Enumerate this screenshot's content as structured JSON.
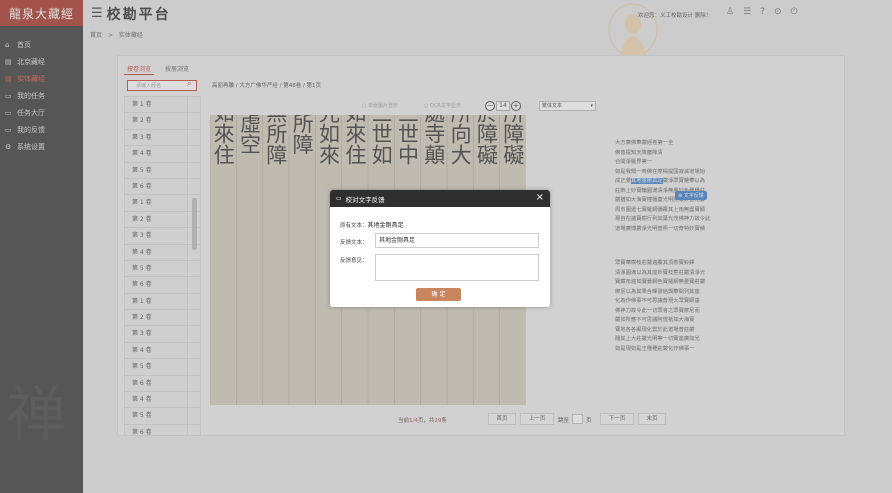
{
  "app": {
    "logo_text": "龍泉大藏經",
    "title": "校勘平台"
  },
  "sidebar": {
    "items": [
      {
        "label": "首页",
        "icon": "home-icon",
        "glyph": "⌂",
        "active": false
      },
      {
        "label": "北京藏经",
        "icon": "book-icon",
        "glyph": "▤",
        "active": false
      },
      {
        "label": "实体藏经",
        "icon": "book-icon",
        "glyph": "▤",
        "active": true
      },
      {
        "label": "我的任务",
        "icon": "task-icon",
        "glyph": "▭",
        "active": false
      },
      {
        "label": "任务大厅",
        "icon": "hall-icon",
        "glyph": "▭",
        "active": false
      },
      {
        "label": "我的反馈",
        "icon": "feedback-icon",
        "glyph": "▭",
        "active": false
      },
      {
        "label": "系统设置",
        "icon": "gear-icon",
        "glyph": "⚙",
        "active": false
      }
    ]
  },
  "header": {
    "welcome": "欢迎您：义工校勘设计 删除！"
  },
  "breadcrumb": {
    "home": "首页",
    "sep": ">",
    "current": "实体藏经"
  },
  "tabs": [
    {
      "label": "按卷浏览",
      "active": true
    },
    {
      "label": "按册浏览",
      "active": false
    }
  ],
  "search": {
    "placeholder": "请输入经名"
  },
  "volumes": [
    "第 1 卷",
    "第 2 卷",
    "第 3 卷",
    "第 4 卷",
    "第 5 卷",
    "第 6 卷",
    "第 1 卷",
    "第 2 卷",
    "第 3 卷",
    "第 4 卷",
    "第 5 卷",
    "第 6 卷",
    "第 1 卷",
    "第 2 卷",
    "第 3 卷",
    "第 4 卷",
    "第 5 卷",
    "第 6 卷",
    "第 4 卷",
    "第 5 卷",
    "第 6 卷"
  ],
  "viewer": {
    "path": "高丽再雕 / 大方广佛华严经 / 第48卷 / 第1页",
    "option_a": "单张图片显示",
    "option_b": "OCR文字显示",
    "page_value": "14",
    "text_select": "繁体文本",
    "minus": "−",
    "plus": "+"
  },
  "scan_columns": [
    "無所障礙",
    "前於障礙",
    "然所向大",
    "非處寺顛",
    "于三世中",
    "法三世如",
    "住如來住",
    "陰光如來",
    "無所障",
    "障無所障",
    "如虛空",
    "障如來住"
  ],
  "text_lines": {
    "p1": [
      "大方廣佛華嚴經卷第一全",
      "佛菩提知天降魔降清",
      "合開淨羅界第一",
      "如是我聞一時佛在摩揭提國寂滅道場始",
      "成正覺其地金剛具足嚴淨眾寶雜華以為",
      "莊飾上妙寶輪圓滿清淨無量妙色種種莊",
      "嚴猶如大海寶幢幡蓋光明照耀妙香花鬘",
      "周市圍遶七寶羅網彌覆其上雨無盡寶顯",
      "現自在諸寶樹行列其葉光茂佛神力故令此",
      "道場廣博嚴淨光明普照一切奇特妙寶積"
    ],
    "hl_before": "成正覺",
    "hl_text": "其地金剛具足",
    "hl_after": "嚴淨眾寶雜華以為",
    "p2": [
      "眾寶華樹枝莊嚴遍覆其頂懸寶鈴鐸",
      "清淨圓滿以為其座妙寶枝莖莊嚴清淨光",
      "寶藏布遍如寶蔓網色寶羅網無量寶莊嚴",
      "摩尼以為其果含暉發焰與華間列其座",
      "化為作佛事不可思議普現大眾寶網垂",
      "佛神力故令此一切眾會之眾寶摩尼而",
      "嚴如所應不可思議阿僧祇如大海寶",
      "寶地各各顯現化雲於此道場普莊嚴",
      "隨其上大莊嚴光明等一切寶座廣如光",
      "如是現如是王種種莊嚴化作佛事一"
    ]
  },
  "feedback_chip": "文字反馈",
  "pagination": {
    "info_prefix": "当前",
    "current": "1/4",
    "info_mid": "页，共",
    "total": "29",
    "info_suffix": "条",
    "first": "首页",
    "prev": "上一页",
    "jump": "跳至",
    "unit": "页",
    "next": "下一页",
    "last": "末页"
  },
  "modal": {
    "title": "校对文字反馈",
    "original_label": "原有文本：",
    "original_value": "其地金剛具足",
    "feedback_label": "反馈文本：",
    "feedback_value": "其地金剛具足",
    "opinion_label": "反馈意见：",
    "confirm": "确 定",
    "close": "×"
  }
}
